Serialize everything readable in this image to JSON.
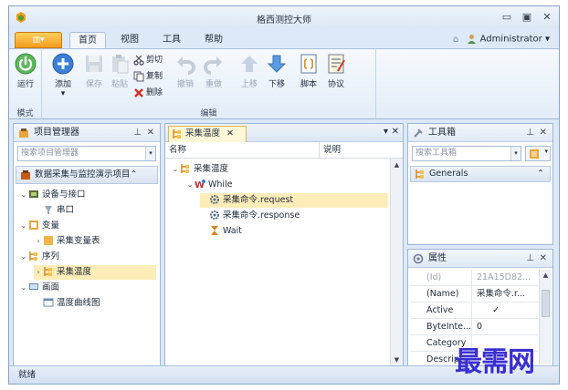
{
  "window": {
    "title": "格西测控大师",
    "min_glyph": "▭",
    "max_glyph": "▣",
    "close_glyph": "✕"
  },
  "tabs": {
    "app_menu": "▥▾",
    "items": [
      "首页",
      "视图",
      "工具",
      "帮助"
    ],
    "active": "首页"
  },
  "user": {
    "name": "Administrator",
    "caret": "▾"
  },
  "ribbon": {
    "mode_group": {
      "label": "模式",
      "run": "运行"
    },
    "edit_group": {
      "label": "编辑",
      "add": "添加",
      "add_caret": "▾",
      "save": "保存",
      "paste": "粘贴",
      "cut": "剪切",
      "copy": "复制",
      "delete": "删除",
      "undo": "撤销",
      "redo": "重做",
      "up": "上移",
      "down": "下移",
      "script": "脚本",
      "protocol": "协议"
    }
  },
  "project_manager": {
    "title": "项目管理器",
    "pin": "⊥",
    "close": "✕",
    "search_placeholder": "搜索项目管理器",
    "project_name": "数据采集与监控演示项目",
    "project_caret": "⌃",
    "tree": [
      {
        "label": "设备与接口",
        "level": 0,
        "arrow": "⌄"
      },
      {
        "label": "串口",
        "level": 1,
        "arrow": ""
      },
      {
        "label": "变量",
        "level": 0,
        "arrow": "⌄"
      },
      {
        "label": "采集变量表",
        "level": 1,
        "arrow": "›"
      },
      {
        "label": "序列",
        "level": 0,
        "arrow": "⌄"
      },
      {
        "label": "采集温度",
        "level": 1,
        "arrow": "›",
        "selected": true
      },
      {
        "label": "画面",
        "level": 0,
        "arrow": "⌄"
      },
      {
        "label": "温度曲线图",
        "level": 1,
        "arrow": ""
      }
    ]
  },
  "editor": {
    "tab_label": "采集温度",
    "tab_close": "✕",
    "menu_caret": "▾",
    "close": "✕",
    "columns": {
      "name": "名称",
      "desc": "说明"
    },
    "tree": [
      {
        "label": "采集温度",
        "level": 0,
        "arrow": "⌄"
      },
      {
        "label": "While",
        "level": 1,
        "arrow": "⌄"
      },
      {
        "label": "采集命令.request",
        "level": 2,
        "arrow": "",
        "selected": true
      },
      {
        "label": "采集命令.response",
        "level": 2,
        "arrow": ""
      },
      {
        "label": "Wait",
        "level": 2,
        "arrow": ""
      }
    ],
    "scroll_up": "▲",
    "scroll_down": "▼"
  },
  "toolbox": {
    "title": "工具箱",
    "pin": "⊥",
    "close": "✕",
    "search_placeholder": "搜索工具箱",
    "group": "Generals",
    "group_caret": "⌃"
  },
  "properties": {
    "title": "属性",
    "pin": "⊥",
    "close": "✕",
    "rows": [
      {
        "key": "(Id)",
        "value": "21A15D82...",
        "disabled": true
      },
      {
        "key": "(Name)",
        "value": "采集命令.r...",
        "disabled": false
      },
      {
        "key": "Active",
        "value": "✓",
        "disabled": false
      },
      {
        "key": "ByteInte...",
        "value": "0",
        "disabled": false
      },
      {
        "key": "Category",
        "value": "",
        "disabled": false
      },
      {
        "key": "Descript...",
        "value": "",
        "disabled": false
      }
    ]
  },
  "status": {
    "text": "就绪"
  },
  "watermark": "最需网",
  "colors": {
    "accent_orange": "#f29c1f",
    "selection": "#fdedb8",
    "watermark": "#3a2fd0"
  }
}
